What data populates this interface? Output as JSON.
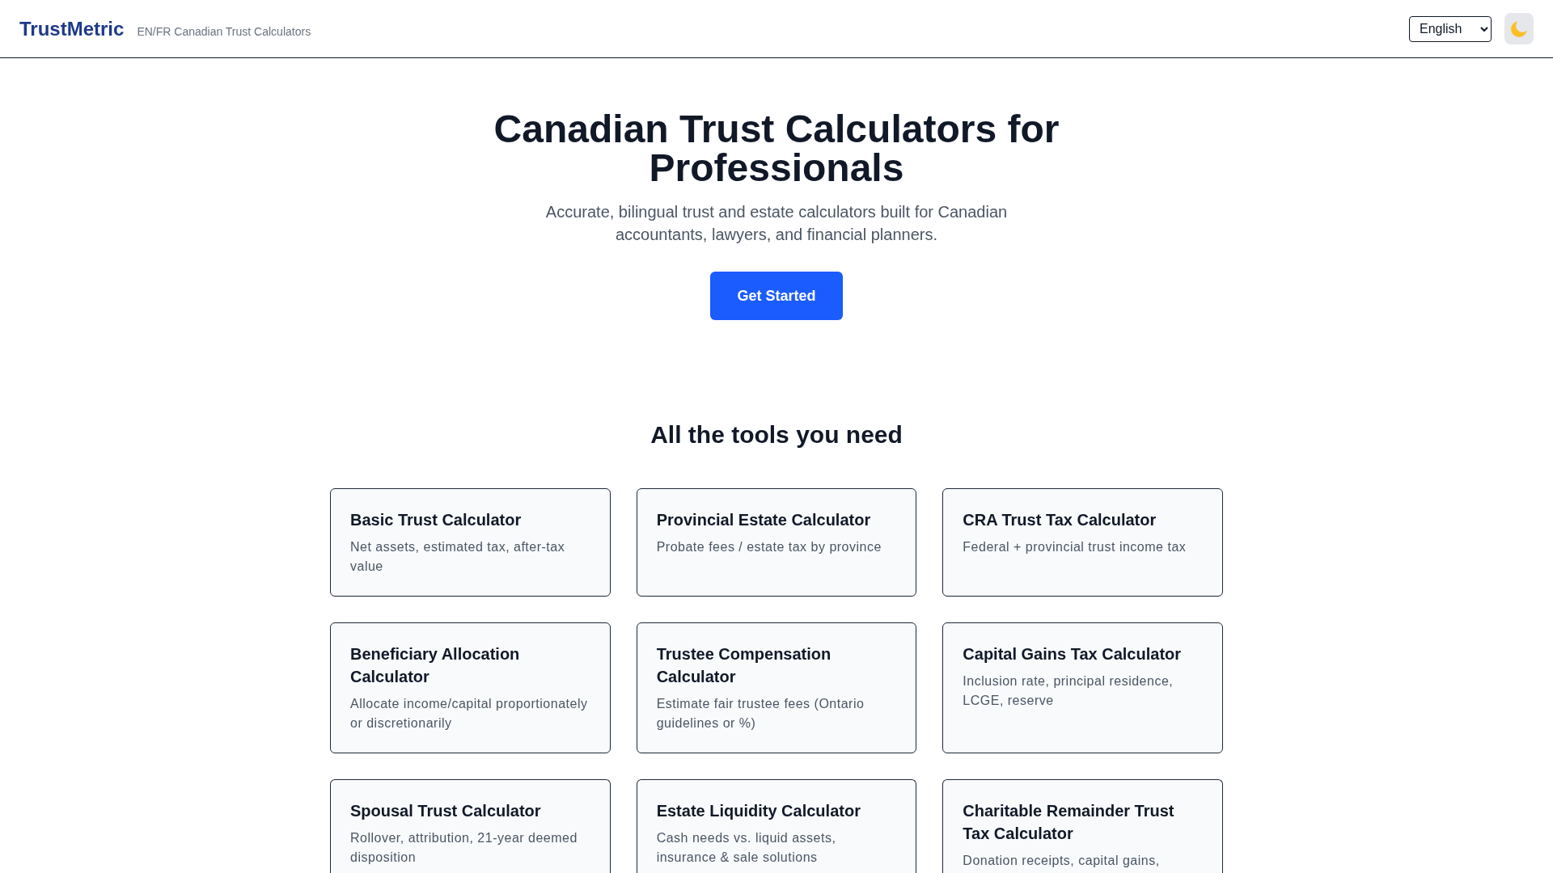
{
  "header": {
    "logo": "TrustMetric",
    "tagline": "EN/FR Canadian Trust Calculators",
    "language_select": {
      "value": "English"
    }
  },
  "hero": {
    "title": "Canadian Trust Calculators for Professionals",
    "subtitle": "Accurate, bilingual trust and estate calculators built for Canadian accountants, lawyers, and financial planners.",
    "cta_button": "Get Started"
  },
  "tools": {
    "heading": "All the tools you need",
    "cards": [
      {
        "title": "Basic Trust Calculator",
        "description": "Net assets, estimated tax, after-tax value"
      },
      {
        "title": "Provincial Estate Calculator",
        "description": "Probate fees / estate tax by province"
      },
      {
        "title": "CRA Trust Tax Calculator",
        "description": "Federal + provincial trust income tax"
      },
      {
        "title": "Beneficiary Allocation Calculator",
        "description": "Allocate income/capital proportionately or discretionarily"
      },
      {
        "title": "Trustee Compensation Calculator",
        "description": "Estimate fair trustee fees (Ontario guidelines or %)"
      },
      {
        "title": "Capital Gains Tax Calculator",
        "description": "Inclusion rate, principal residence, LCGE, reserve"
      },
      {
        "title": "Spousal Trust Calculator",
        "description": "Rollover, attribution, 21-year deemed disposition"
      },
      {
        "title": "Estate Liquidity Calculator",
        "description": "Cash needs vs. liquid assets, insurance & sale solutions"
      },
      {
        "title": "Charitable Remainder Trust Tax Calculator",
        "description": "Donation receipts, capital gains,"
      }
    ]
  }
}
